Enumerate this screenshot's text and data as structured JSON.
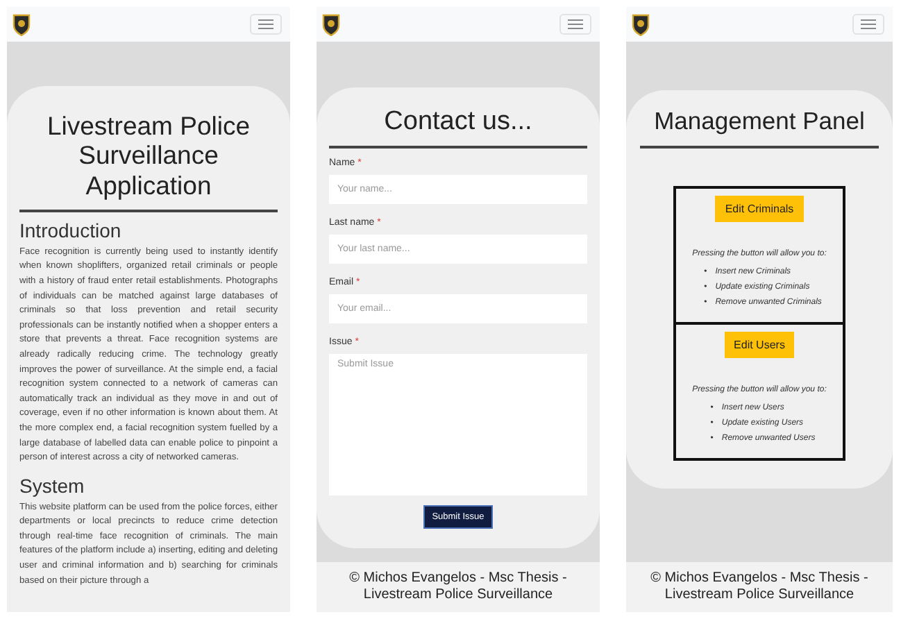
{
  "screens": [
    {
      "kind": "article",
      "title": "Livestream Police Surveillance Application",
      "sections": [
        {
          "heading": "Introduction",
          "text": "Face recognition is currently being used to instantly identify when known shoplifters, organized retail criminals or people with a history of fraud enter retail establishments. Photographs of individuals can be matched against large databases of criminals so that loss prevention and retail security professionals can be instantly notified when a shopper enters a store that prevents a threat. Face recognition systems are already radically reducing crime. The technology greatly improves the power of surveillance. At the simple end, a facial recognition system connected to a network of cameras can automatically track an individual as they move in and out of coverage, even if no other information is known about them. At the more complex end, a facial recognition system fuelled by a large database of labelled data can enable police to pinpoint a person of interest across a city of networked cameras."
        },
        {
          "heading": "System",
          "text": "This website platform can be used from the police forces, either departments or local precincts to reduce crime detection through real-time face recognition of criminals. The main features of the platform include a) inserting, editing and deleting user and criminal information and b) searching for criminals based on their picture through a"
        }
      ]
    },
    {
      "kind": "contact",
      "title": "Contact us...",
      "fields": [
        {
          "kind": "input",
          "label": "Name",
          "mark": "*",
          "placeholder": "Your name..."
        },
        {
          "kind": "input",
          "label": "Last name",
          "mark": "*",
          "placeholder": "Your last name..."
        },
        {
          "kind": "input",
          "label": "Email",
          "mark": "*",
          "placeholder": "Your email..."
        },
        {
          "kind": "textarea",
          "label": "Issue",
          "mark": "*",
          "placeholder": "Submit Issue"
        }
      ],
      "submit": "Submit Issue",
      "footer": "© Michos Evangelos - Msc Thesis - Livestream Police Surveillance"
    },
    {
      "kind": "panel",
      "title": "Management Panel",
      "boxes": [
        {
          "button": "Edit Criminals",
          "bullet": "•",
          "intro": "Pressing the button will allow you to:",
          "items": [
            "Insert new Criminals",
            "Update existing Criminals",
            "Remove unwanted Criminals"
          ]
        },
        {
          "button": "Edit Users",
          "bullet": "•",
          "intro": "Pressing the button will allow you to:",
          "items": [
            "Insert new Users",
            "Update existing Users",
            "Remove unwanted Users"
          ]
        }
      ],
      "footer": "© Michos Evangelos - Msc Thesis - Livestream Police Surveillance"
    }
  ]
}
